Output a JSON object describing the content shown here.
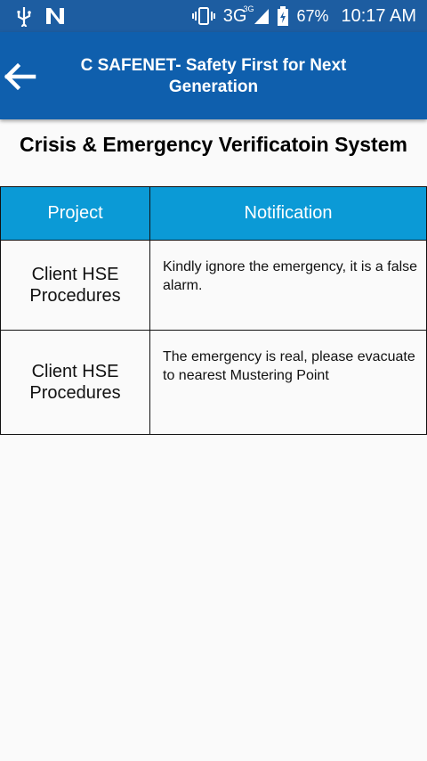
{
  "status_bar": {
    "network": "3G",
    "network_sup": "3G",
    "battery": "67%",
    "time": "10:17 AM",
    "icons": [
      "usb-icon",
      "notification-n-icon",
      "vibrate-icon",
      "signal-icon",
      "battery-icon"
    ]
  },
  "app_bar": {
    "title": "C SAFENET- Safety First for Next Generation",
    "back_icon": "back-arrow-icon",
    "color": "#0f5fad"
  },
  "page": {
    "heading": "Crisis & Emergency Verificatoin System"
  },
  "table": {
    "header_color": "#0b9ad6",
    "headers": [
      "Project",
      "Notification"
    ],
    "rows": [
      {
        "project": "Client HSE Procedures",
        "notification": "Kindly ignore the emergency, it is a false alarm."
      },
      {
        "project": "Client HSE Procedures",
        "notification": "The emergency is real, please evacuate to nearest Mustering Point"
      }
    ]
  }
}
